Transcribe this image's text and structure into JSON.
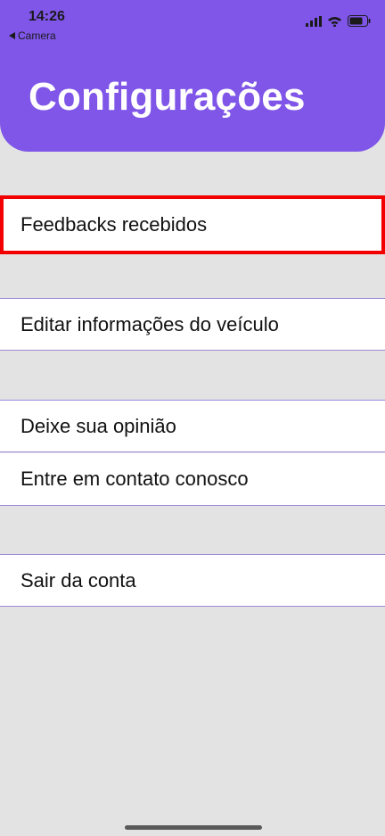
{
  "status_bar": {
    "time": "14:26",
    "back_app": "Camera"
  },
  "header": {
    "title": "Configurações",
    "color": "#7f56e8"
  },
  "menu": {
    "items": [
      {
        "label": "Feedbacks recebidos"
      },
      {
        "label": "Editar informações do veículo"
      },
      {
        "label": "Deixe sua opinião"
      },
      {
        "label": "Entre em contato conosco"
      },
      {
        "label": "Sair da conta"
      }
    ]
  },
  "icons": [
    "back-arrow-icon",
    "signal-icon",
    "wifi-icon",
    "battery-icon"
  ]
}
